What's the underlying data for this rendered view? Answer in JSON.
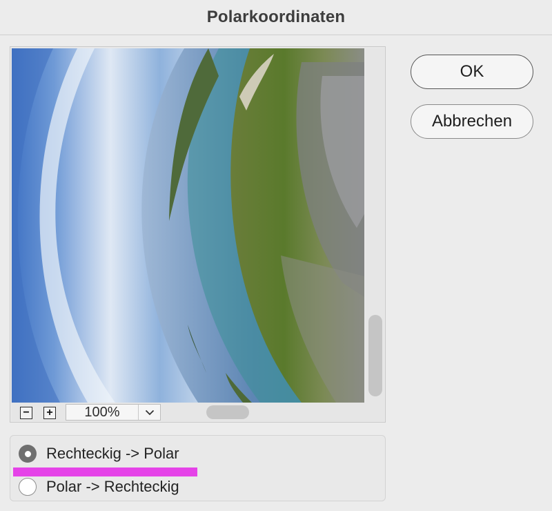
{
  "dialog": {
    "title": "Polarkoordinaten"
  },
  "buttons": {
    "ok_label": "OK",
    "cancel_label": "Abbrechen"
  },
  "preview": {
    "zoom_level": "100%",
    "zoom_out_symbol": "−",
    "zoom_in_symbol": "+",
    "image_description_icon": "preview-image"
  },
  "options": {
    "items": [
      {
        "label": "Rechteckig -> Polar",
        "selected": true
      },
      {
        "label": "Polar -> Rechteckig",
        "selected": false
      }
    ]
  },
  "colors": {
    "highlight": "#e543e8",
    "background": "#ececec"
  }
}
